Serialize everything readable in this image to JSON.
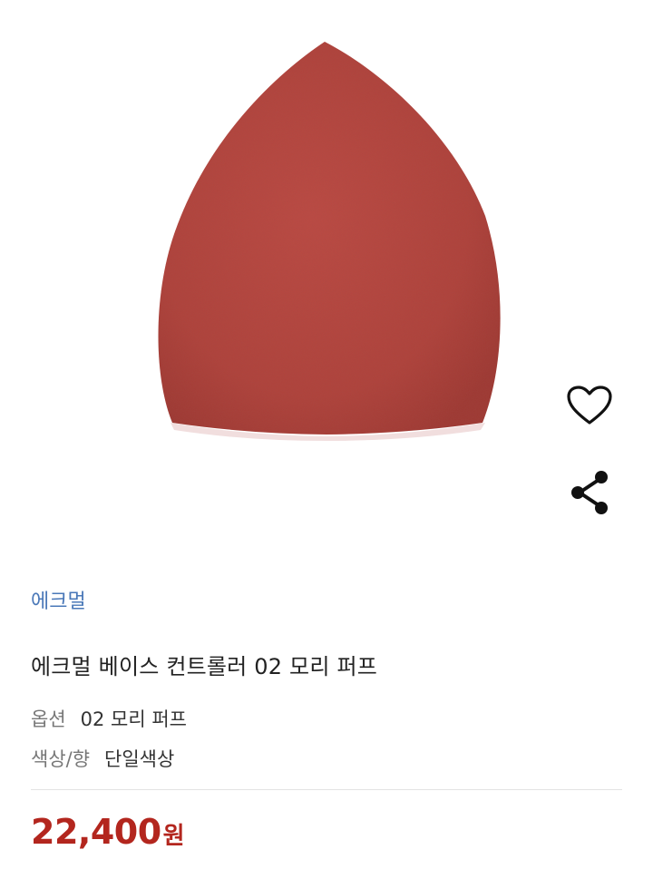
{
  "product": {
    "brand": "에크멀",
    "title": "에크멀 베이스 컨트롤러 02 모리 퍼프",
    "options": [
      {
        "label": "옵션",
        "value": "02 모리 퍼프"
      },
      {
        "label": "색상/향",
        "value": "단일색상"
      }
    ],
    "price": "22,400",
    "price_unit": "원",
    "image_subject": "red teardrop makeup sponge",
    "colors": {
      "sponge": "#b6463e",
      "brand_link": "#4a78b8",
      "price": "#b3261e"
    }
  },
  "icons": {
    "wishlist": "heart-icon",
    "share": "share-icon"
  }
}
